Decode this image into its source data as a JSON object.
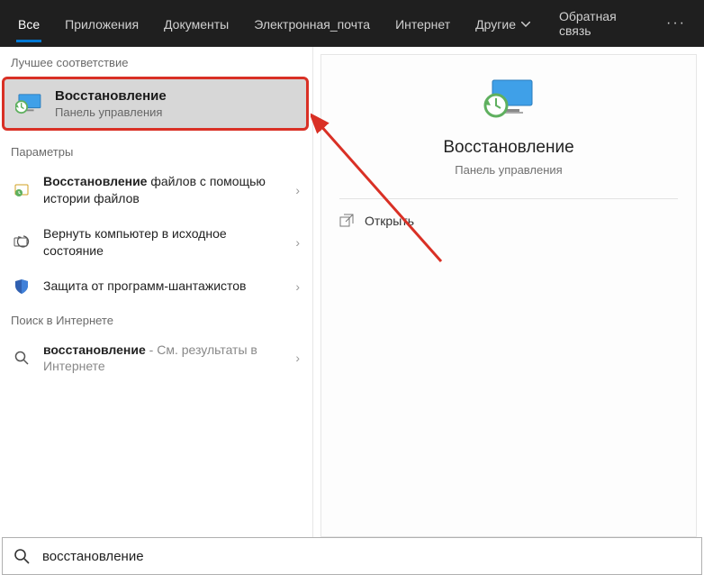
{
  "tabs": [
    "Все",
    "Приложения",
    "Документы",
    "Электронная_почта",
    "Интернет",
    "Другие"
  ],
  "feedback": "Обратная связь",
  "sections": {
    "best_match": "Лучшее соответствие",
    "settings": "Параметры",
    "web": "Поиск в Интернете"
  },
  "best_match": {
    "title": "Восстановление",
    "subtitle": "Панель управления"
  },
  "settings_items": [
    {
      "title_bold": "Восстановление",
      "title_rest": " файлов с помощью истории файлов"
    },
    {
      "title": "Вернуть компьютер в исходное состояние"
    },
    {
      "title": "Защита от программ-шантажистов"
    }
  ],
  "web_item": {
    "title_bold": "восстановление",
    "rest": " - См. результаты в Интернете"
  },
  "preview": {
    "title": "Восстановление",
    "subtitle": "Панель управления",
    "open": "Открыть"
  },
  "search_value": "восстановление"
}
